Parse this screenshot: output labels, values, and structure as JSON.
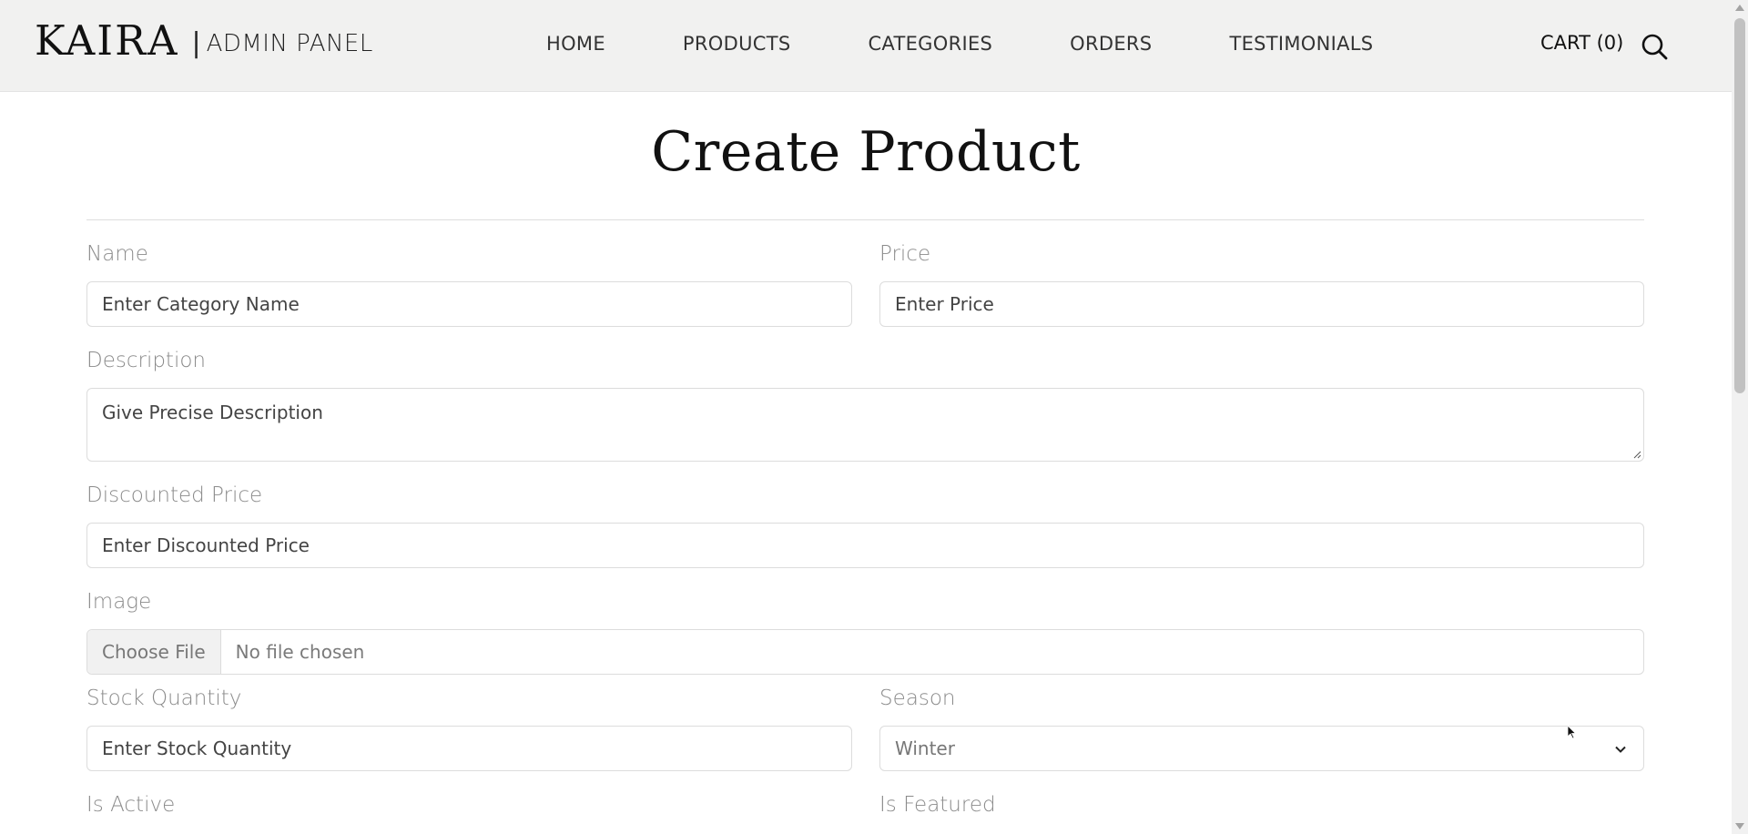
{
  "header": {
    "logo": "KAIRA",
    "separator": "|",
    "subtitle": "ADMIN PANEL",
    "nav": [
      "HOME",
      "PRODUCTS",
      "CATEGORIES",
      "ORDERS",
      "TESTIMONIALS"
    ],
    "cart": "CART (0)"
  },
  "page": {
    "title": "Create Product"
  },
  "form": {
    "name": {
      "label": "Name",
      "placeholder": "Enter Category Name"
    },
    "price": {
      "label": "Price",
      "placeholder": "Enter Price"
    },
    "description": {
      "label": "Description",
      "placeholder": "Give Precise Description"
    },
    "discounted_price": {
      "label": "Discounted Price",
      "placeholder": "Enter Discounted Price"
    },
    "image": {
      "label": "Image",
      "button": "Choose File",
      "status": "No file chosen"
    },
    "stock_quantity": {
      "label": "Stock Quantity",
      "placeholder": "Enter Stock Quantity"
    },
    "season": {
      "label": "Season",
      "selected": "Winter"
    },
    "is_active": {
      "label": "Is Active"
    },
    "is_featured": {
      "label": "Is Featured"
    }
  },
  "icons": {
    "search": "search-icon",
    "select": "chevron-down-icon",
    "cursor": "mouse-pointer-icon"
  }
}
